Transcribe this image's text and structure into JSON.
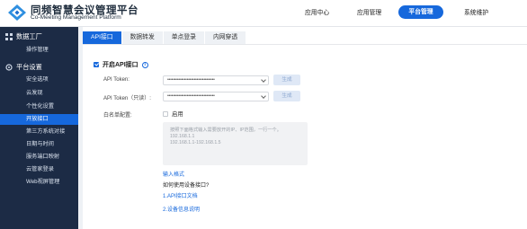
{
  "header": {
    "brand_cn": "同频智慧会议管理平台",
    "brand_en": "Co-Meeting Management Platform",
    "nav": [
      "应用中心",
      "应用管理",
      "平台管理",
      "系统维护"
    ],
    "active_nav": "平台管理"
  },
  "sidebar": {
    "group1": "数据工厂",
    "group1_items": [
      "操作管理"
    ],
    "group2": "平台设置",
    "group2_items": [
      "安全选项",
      "云发现",
      "个性化设置",
      "开放接口",
      "第三方系统对接",
      "日期与时间",
      "服务端口映射",
      "云管家登录",
      "Web视屏管理"
    ],
    "active_item": "开放接口"
  },
  "tabs": [
    "API接口",
    "数据转发",
    "单点登录",
    "内网穿透"
  ],
  "form": {
    "enable_label": "开启API接口",
    "api_token_label": "API Token:",
    "api_token_value": "••••••••••••••••••••••••••••••••••",
    "api_token_readonly_label": "API Token（只读）:",
    "api_token_readonly_value": "••••••••••••••••••••••••••••••••••",
    "generate_label": "生成",
    "whitelist_label": "白名单配置:",
    "whitelist_enable": "启用",
    "whitelist_placeholder_lines": [
      "按照下面格式输入需要放开的IP、IP范围，一行一个。",
      "192.168.1.1",
      "192.168.1.1-192.168.1.5"
    ],
    "format_link": "输入格式",
    "help_title": "如何使用设备接口?",
    "help_link1": "1.API接口文档",
    "help_link2": "2.设备信息说明"
  },
  "colors": {
    "accent": "#1668dc",
    "sidebar_bg": "#1c2b45"
  }
}
